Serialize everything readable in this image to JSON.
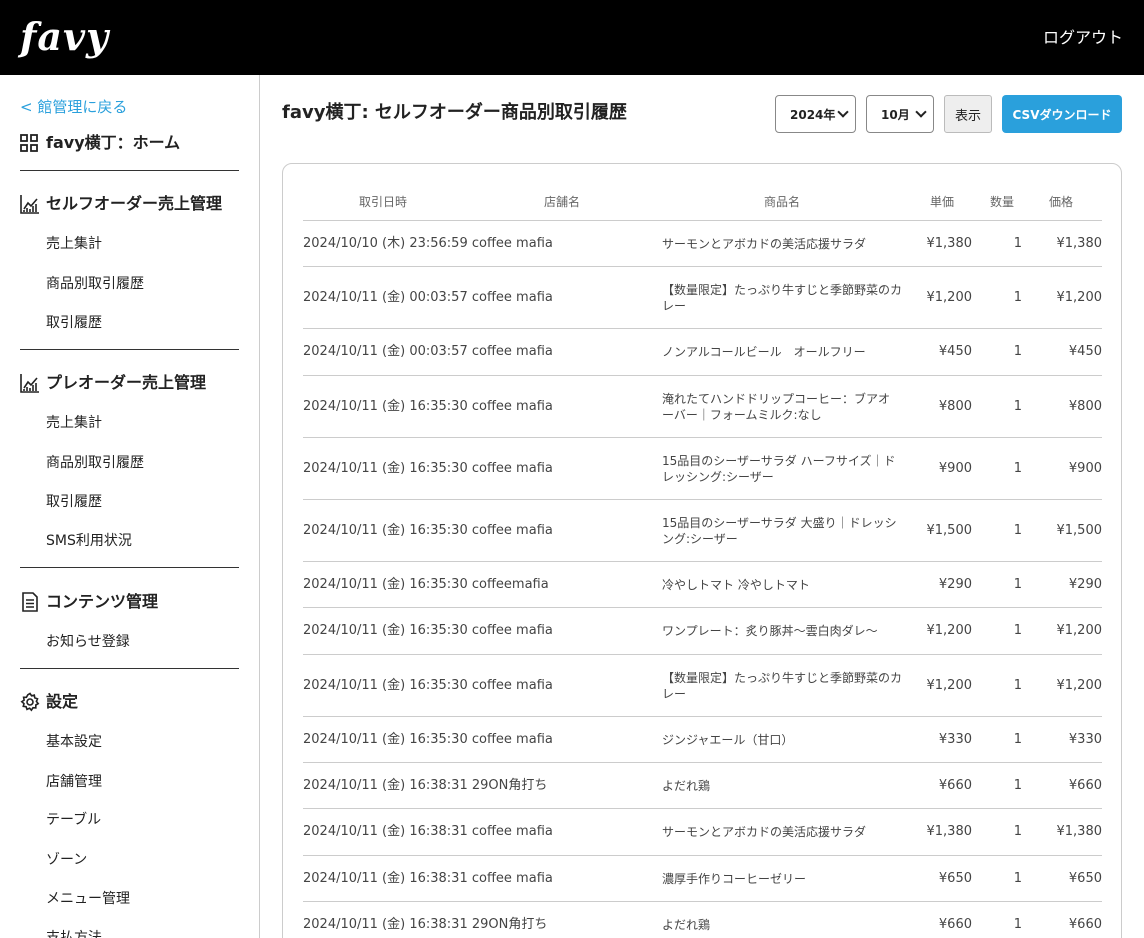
{
  "header": {
    "logo": "favy",
    "logout": "ログアウト"
  },
  "sidebar": {
    "back": "< 館管理に戻る",
    "home": "favy横丁：ホーム",
    "sections": [
      {
        "title": "セルフオーダー売上管理",
        "icon": "chart-icon",
        "items": [
          "売上集計",
          "商品別取引履歴",
          "取引履歴"
        ]
      },
      {
        "title": "プレオーダー売上管理",
        "icon": "chart-icon",
        "items": [
          "売上集計",
          "商品別取引履歴",
          "取引履歴",
          "SMS利用状況"
        ]
      },
      {
        "title": "コンテンツ管理",
        "icon": "document-icon",
        "items": [
          "お知らせ登録"
        ]
      },
      {
        "title": "設定",
        "icon": "gear-icon",
        "items": [
          "基本設定",
          "店舗管理",
          "テーブル",
          "ゾーン",
          "メニュー管理",
          "支払方法"
        ]
      }
    ]
  },
  "main": {
    "title": "favy横丁: セルフオーダー商品別取引履歴",
    "year_select": "2024年",
    "month_select": "10月",
    "show_button": "表示",
    "csv_button": "CSVダウンロード"
  },
  "table": {
    "headers": {
      "date": "取引日時",
      "shop": "店舗名",
      "product": "商品名",
      "price": "単価",
      "qty": "数量",
      "total": "価格"
    },
    "rows": [
      {
        "date": "2024/10/10 (木) 23:56:59",
        "shop": "coffee mafia",
        "product": "サーモンとアボカドの美活応援サラダ",
        "price": "¥1,380",
        "qty": "1",
        "total": "¥1,380"
      },
      {
        "date": "2024/10/11 (金) 00:03:57",
        "shop": "coffee mafia",
        "product": "【数量限定】たっぷり牛すじと季節野菜のカレー",
        "price": "¥1,200",
        "qty": "1",
        "total": "¥1,200"
      },
      {
        "date": "2024/10/11 (金) 00:03:57",
        "shop": "coffee mafia",
        "product": "ノンアルコールビール　オールフリー",
        "price": "¥450",
        "qty": "1",
        "total": "¥450"
      },
      {
        "date": "2024/10/11 (金) 16:35:30",
        "shop": "coffee mafia",
        "product": "淹れたてハンドドリップコーヒー：ブアオーバー｜フォームミルク:なし",
        "price": "¥800",
        "qty": "1",
        "total": "¥800"
      },
      {
        "date": "2024/10/11 (金) 16:35:30",
        "shop": "coffee mafia",
        "product": "15品目のシーザーサラダ ハーフサイズ｜ドレッシング:シーザー",
        "price": "¥900",
        "qty": "1",
        "total": "¥900"
      },
      {
        "date": "2024/10/11 (金) 16:35:30",
        "shop": "coffee mafia",
        "product": "15品目のシーザーサラダ 大盛り｜ドレッシング:シーザー",
        "price": "¥1,500",
        "qty": "1",
        "total": "¥1,500"
      },
      {
        "date": "2024/10/11 (金) 16:35:30",
        "shop": "coffeemafia",
        "product": "冷やしトマト 冷やしトマト",
        "price": "¥290",
        "qty": "1",
        "total": "¥290"
      },
      {
        "date": "2024/10/11 (金) 16:35:30",
        "shop": "coffee mafia",
        "product": "ワンプレート：炙り豚丼〜雲白肉ダレ〜",
        "price": "¥1,200",
        "qty": "1",
        "total": "¥1,200"
      },
      {
        "date": "2024/10/11 (金) 16:35:30",
        "shop": "coffee mafia",
        "product": "【数量限定】たっぷり牛すじと季節野菜のカレー",
        "price": "¥1,200",
        "qty": "1",
        "total": "¥1,200"
      },
      {
        "date": "2024/10/11 (金) 16:35:30",
        "shop": "coffee mafia",
        "product": "ジンジャエール（甘口）",
        "price": "¥330",
        "qty": "1",
        "total": "¥330"
      },
      {
        "date": "2024/10/11 (金) 16:38:31",
        "shop": "29ON角打ち",
        "product": "よだれ鶏",
        "price": "¥660",
        "qty": "1",
        "total": "¥660"
      },
      {
        "date": "2024/10/11 (金) 16:38:31",
        "shop": "coffee mafia",
        "product": "サーモンとアボカドの美活応援サラダ",
        "price": "¥1,380",
        "qty": "1",
        "total": "¥1,380"
      },
      {
        "date": "2024/10/11 (金) 16:38:31",
        "shop": "coffee mafia",
        "product": "濃厚手作りコーヒーゼリー",
        "price": "¥650",
        "qty": "1",
        "total": "¥650"
      },
      {
        "date": "2024/10/11 (金) 16:38:31",
        "shop": "29ON角打ち",
        "product": "よだれ鶏",
        "price": "¥660",
        "qty": "1",
        "total": "¥660"
      }
    ]
  }
}
